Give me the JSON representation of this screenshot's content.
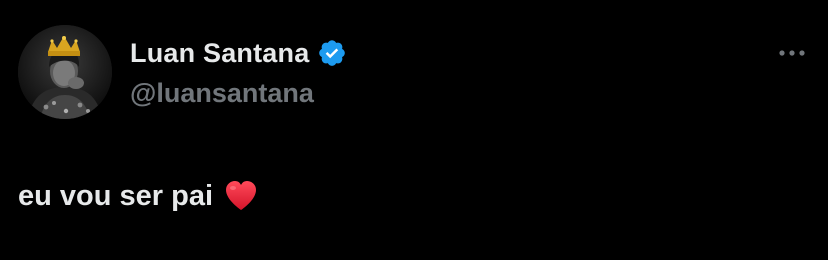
{
  "tweet": {
    "author": {
      "display_name": "Luan Santana",
      "handle": "@luansantana",
      "verified": true
    },
    "text": "eu vou ser pai",
    "emoji": "heart-emoji"
  },
  "colors": {
    "background": "#000000",
    "primary_text": "#e7e9ea",
    "secondary_text": "#71767b",
    "verified_badge": "#1d9bf0",
    "heart": "#e0182d"
  },
  "icons": {
    "verified": "verified-badge-icon",
    "more": "more-options-icon"
  }
}
